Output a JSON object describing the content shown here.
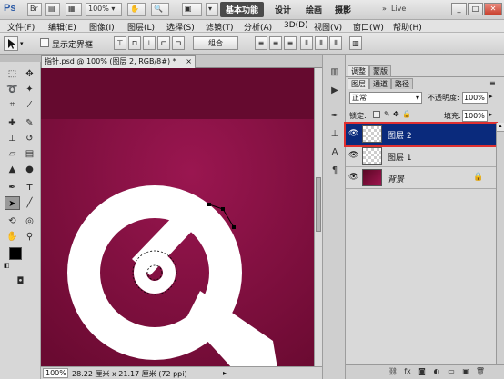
{
  "titlebar": {
    "app_logo": "Ps",
    "zoom": "100%",
    "workspaces": [
      "基本功能",
      "设计",
      "绘画",
      "摄影"
    ],
    "search_text": "Live"
  },
  "menu": [
    "文件(F)",
    "编辑(E)",
    "图像(I)",
    "图层(L)",
    "选择(S)",
    "滤镜(T)",
    "分析(A)",
    "3D(D)",
    "视图(V)",
    "窗口(W)",
    "帮助(H)"
  ],
  "options": {
    "show_bounds_label": "显示定界框",
    "combine_label": "组合"
  },
  "document": {
    "tab_label": "指针.psd @ 100% (图层 2, RGB/8#) *"
  },
  "status": {
    "zoom": "100%",
    "info": "28.22 厘米 x 21.17 厘米 (72 ppi)"
  },
  "panel": {
    "tabs_top": [
      "调整",
      "蒙版"
    ],
    "tabs": [
      "图层",
      "通道",
      "路径"
    ],
    "blend_mode": "正常",
    "opacity_label": "不透明度:",
    "opacity_value": "100%",
    "lock_label": "锁定:",
    "fill_label": "填充:",
    "fill_value": "100%",
    "layers": [
      {
        "name": "图层 2",
        "selected": true
      },
      {
        "name": "图层 1",
        "selected": false
      },
      {
        "name": "背景",
        "selected": false
      }
    ]
  },
  "colors": {
    "canvas": "#7a0d39",
    "selection": "#0a2a7c",
    "highlight_box": "#e03030"
  }
}
